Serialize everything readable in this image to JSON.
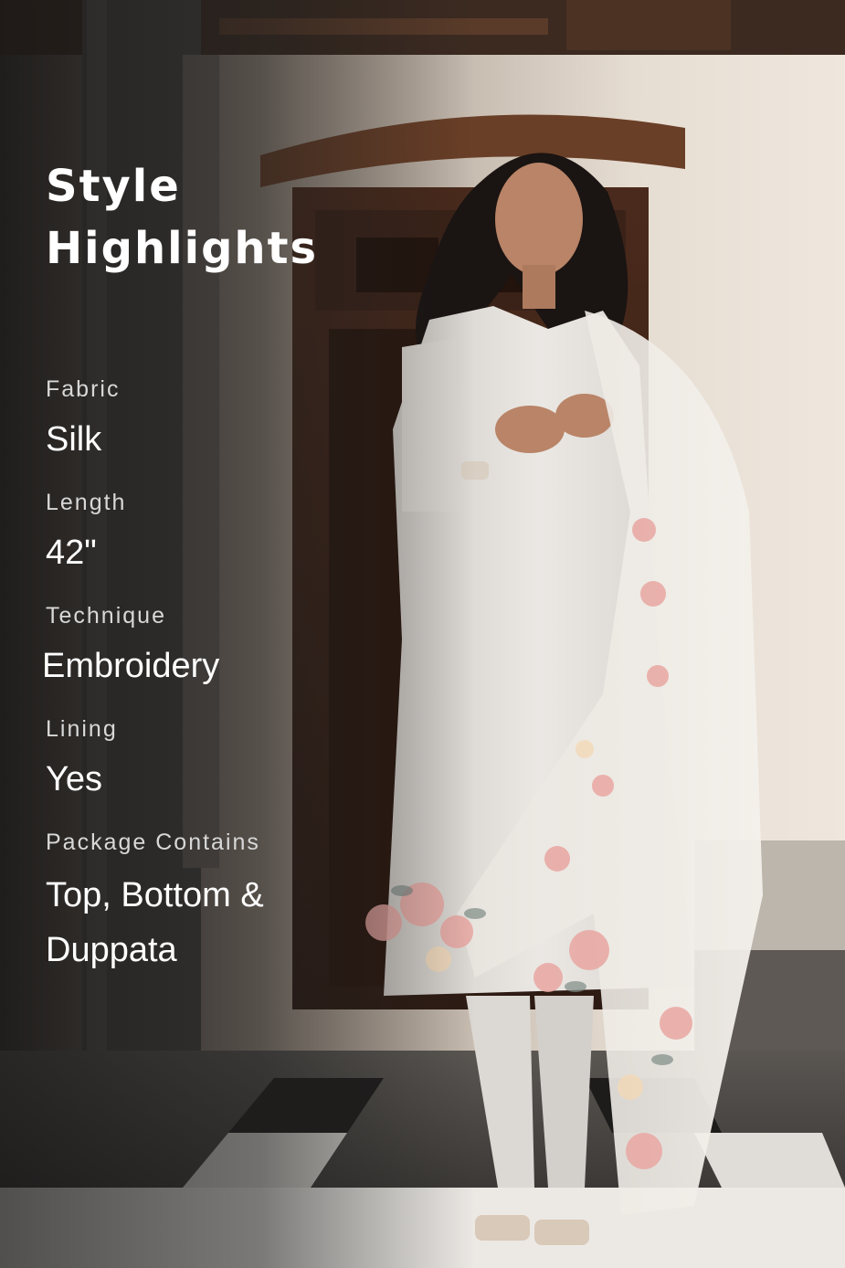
{
  "heading": {
    "title": "Style Highlights"
  },
  "specs": [
    {
      "label": "Fabric",
      "value": "Silk"
    },
    {
      "label": "Length",
      "value": "42\""
    },
    {
      "label": "Technique",
      "value": "Embroidery"
    },
    {
      "label": "Lining",
      "value": "Yes"
    },
    {
      "label": "Package Contains",
      "value": "Top, Bottom & Duppata"
    }
  ],
  "colors": {
    "text_primary": "#ffffff",
    "text_label": "#d8d8d8",
    "outfit": "#e6e2dd",
    "floral_accent": "#e9a7a2"
  }
}
